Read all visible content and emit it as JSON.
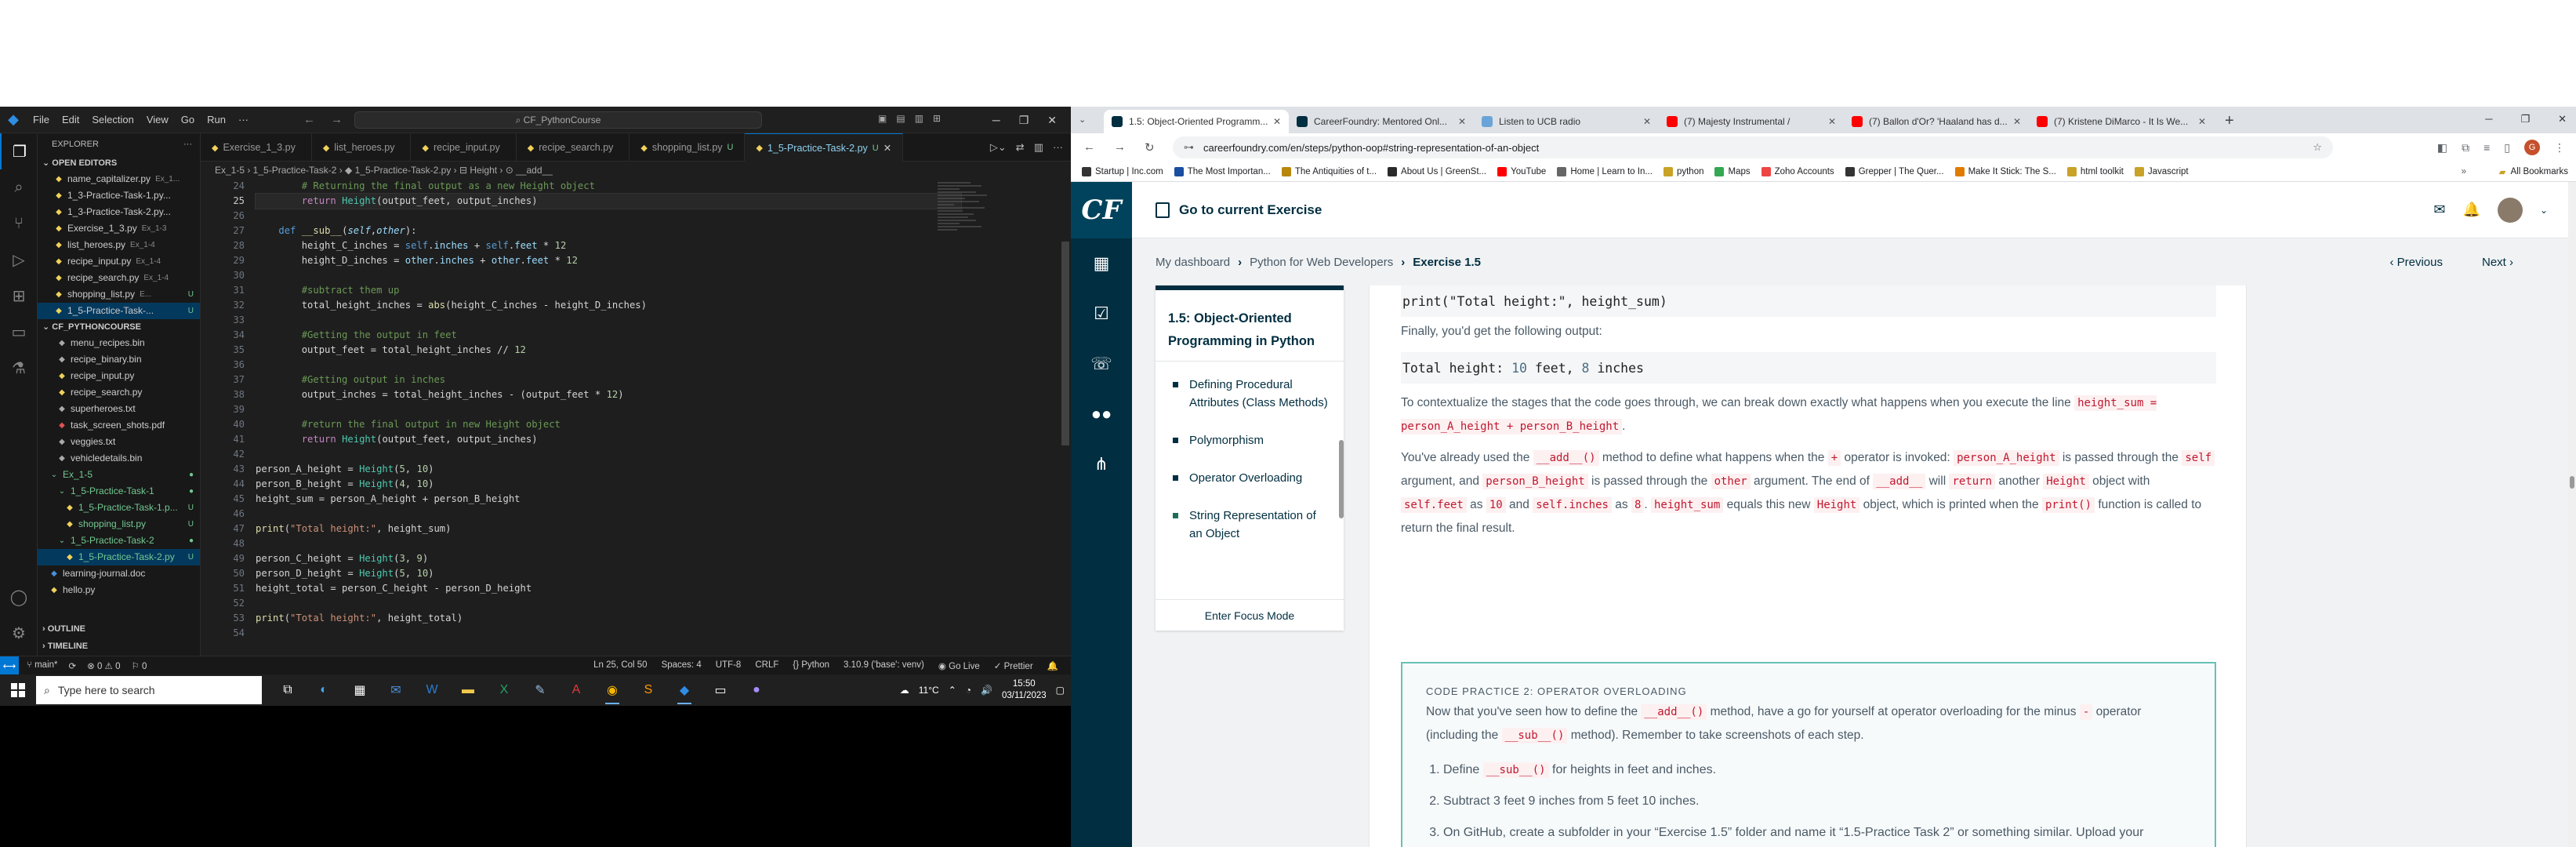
{
  "vscode": {
    "title_search": "CF_PythonCourse",
    "menu": [
      "File",
      "Edit",
      "Selection",
      "View",
      "Go",
      "Run",
      "···"
    ],
    "explorer_title": "EXPLORER",
    "open_editors_label": "OPEN EDITORS",
    "open_editors": [
      {
        "name": "name_capitalizer.py",
        "desc": "Ex_1...",
        "status": "",
        "color": "#f0d25a"
      },
      {
        "name": "1_3-Practice-Task-1.py...",
        "desc": "",
        "status": "",
        "color": "#f0d25a"
      },
      {
        "name": "1_3-Practice-Task-2.py...",
        "desc": "",
        "status": "",
        "color": "#f0d25a"
      },
      {
        "name": "Exercise_1_3.py",
        "desc": "Ex_1-3",
        "status": "",
        "color": "#f0d25a"
      },
      {
        "name": "list_heroes.py",
        "desc": "Ex_1-4",
        "status": "",
        "color": "#f0d25a"
      },
      {
        "name": "recipe_input.py",
        "desc": "Ex_1-4",
        "status": "",
        "color": "#f0d25a"
      },
      {
        "name": "recipe_search.py",
        "desc": "Ex_1-4",
        "status": "",
        "color": "#f0d25a"
      },
      {
        "name": "shopping_list.py",
        "desc": "E...",
        "status": "U",
        "color": "#f0d25a"
      },
      {
        "name": "1_5-Practice-Task-...",
        "desc": "",
        "status": "U",
        "color": "#f0d25a"
      }
    ],
    "project_label": "CF_PYTHONCOURSE",
    "project_files": [
      {
        "name": "menu_recipes.bin",
        "indent": 1,
        "status": "",
        "color": "#aaa"
      },
      {
        "name": "recipe_binary.bin",
        "indent": 1,
        "status": "",
        "color": "#aaa"
      },
      {
        "name": "recipe_input.py",
        "indent": 1,
        "status": "",
        "color": "#f0d25a"
      },
      {
        "name": "recipe_search.py",
        "indent": 1,
        "status": "",
        "color": "#f0d25a"
      },
      {
        "name": "superheroes.txt",
        "indent": 1,
        "status": "",
        "color": "#aaa"
      },
      {
        "name": "task_screen_shots.pdf",
        "indent": 1,
        "status": "",
        "color": "#e05252"
      },
      {
        "name": "veggies.txt",
        "indent": 1,
        "status": "",
        "color": "#aaa"
      },
      {
        "name": "vehicledetails.bin",
        "indent": 1,
        "status": "",
        "color": "#aaa"
      },
      {
        "name": "Ex_1-5",
        "indent": 0,
        "status": "●",
        "color": "#73c991"
      },
      {
        "name": "1_5-Practice-Task-1",
        "indent": 1,
        "status": "●",
        "color": "#73c991"
      },
      {
        "name": "1_5-Practice-Task-1.p...",
        "indent": 2,
        "status": "U",
        "color": "#f0d25a"
      },
      {
        "name": "shopping_list.py",
        "indent": 2,
        "status": "U",
        "color": "#f0d25a"
      },
      {
        "name": "1_5-Practice-Task-2",
        "indent": 1,
        "status": "●",
        "color": "#73c991"
      },
      {
        "name": "1_5-Practice-Task-2.py",
        "indent": 2,
        "status": "U",
        "color": "#f0d25a"
      },
      {
        "name": "learning-journal.doc",
        "indent": 0,
        "status": "",
        "color": "#4a90d9"
      },
      {
        "name": "hello.py",
        "indent": 0,
        "status": "",
        "color": "#f0d25a"
      }
    ],
    "outline_label": "OUTLINE",
    "timeline_label": "TIMELINE",
    "tabs": [
      {
        "name": "Exercise_1_3.py",
        "u": ""
      },
      {
        "name": "list_heroes.py",
        "u": ""
      },
      {
        "name": "recipe_input.py",
        "u": ""
      },
      {
        "name": "recipe_search.py",
        "u": ""
      },
      {
        "name": "shopping_list.py",
        "u": "U"
      },
      {
        "name": "1_5-Practice-Task-2.py",
        "u": "U"
      }
    ],
    "breadcrumb": "Ex_1-5 › 1_5-Practice-Task-2 › ◆ 1_5-Practice-Task-2.py › ⊟ Height › ⊙ __add__",
    "line_numbers": [
      "24",
      "25",
      "26",
      "27",
      "28",
      "29",
      "30",
      "31",
      "32",
      "33",
      "34",
      "35",
      "36",
      "37",
      "38",
      "39",
      "40",
      "41",
      "42",
      "43",
      "44",
      "45",
      "46",
      "47",
      "48",
      "49",
      "50",
      "51",
      "52",
      "53",
      "54"
    ],
    "status_left": [
      "⑂ main*",
      "⟳",
      "⊗ 0 ⚠ 0",
      "⚐ 0"
    ],
    "status_right": [
      "Ln 25, Col 50",
      "Spaces: 4",
      "UTF-8",
      "CRLF",
      "{} Python",
      "3.10.9 ('base': venv)",
      "◉ Go Live",
      "✓ Prettier",
      "🔔"
    ]
  },
  "taskbar": {
    "search_placeholder": "Type here to search",
    "weather": "11°C",
    "time": "15:50",
    "date": "03/11/2023"
  },
  "chrome": {
    "tabs": [
      {
        "title": "1.5: Object-Oriented Programm...",
        "color": "#012e40",
        "active": true
      },
      {
        "title": "CareerFoundry: Mentored Onl...",
        "color": "#012e40",
        "active": false
      },
      {
        "title": "Listen to UCB radio",
        "color": "#6ba4d8",
        "active": false
      },
      {
        "title": "(7) Majesty Instrumental /",
        "color": "#ff0000",
        "active": false
      },
      {
        "title": "(7) Ballon d'Or? 'Haaland has d...",
        "color": "#ff0000",
        "active": false
      },
      {
        "title": "(7) Kristene DiMarco - It Is We...",
        "color": "#ff0000",
        "active": false
      }
    ],
    "url": "careerfoundry.com/en/steps/python-oop#string-representation-of-an-object",
    "bookmarks": [
      {
        "label": "Startup | Inc.com",
        "color": "#333"
      },
      {
        "label": "The Most Importan...",
        "color": "#1a4ea0"
      },
      {
        "label": "The Antiquities of t...",
        "color": "#b8860b"
      },
      {
        "label": "About Us | GreenSt...",
        "color": "#2a2a2a"
      },
      {
        "label": "YouTube",
        "color": "#ff0000"
      },
      {
        "label": "Home | Learn to In...",
        "color": "#666"
      },
      {
        "label": "python",
        "color": "#c9a227"
      },
      {
        "label": "Maps",
        "color": "#34a853"
      },
      {
        "label": "Zoho Accounts",
        "color": "#e44"
      },
      {
        "label": "Grepper | The Quer...",
        "color": "#333"
      },
      {
        "label": "Make It Stick: The S...",
        "color": "#e07b00"
      },
      {
        "label": "html toolkit",
        "color": "#c9a227"
      },
      {
        "label": "Javascript",
        "color": "#c9a227"
      }
    ],
    "all_bookmarks": "All Bookmarks"
  },
  "cf": {
    "logo": "CF",
    "go_to_exercise": "Go to current Exercise",
    "crumbs": [
      "My dashboard",
      "Python for Web Developers",
      "Exercise 1.5"
    ],
    "previous": "Previous",
    "next": "Next",
    "sidebar_title": "1.5: Object-Oriented Programming in Python",
    "sidebar_items": [
      {
        "label": "Defining Procedural Attributes (Class Methods)"
      },
      {
        "label": "Polymorphism"
      },
      {
        "label": "Operator Overloading"
      },
      {
        "label": "String Representation of an Object"
      }
    ],
    "focus_mode": "Enter Focus Mode",
    "code1_text": "print(\"Total height:\", height_sum)",
    "finally_text": "Finally, you'd get the following output:",
    "output_label": "Total height: ",
    "output_num1": "10",
    "output_mid": " feet, ",
    "output_num2": "8",
    "output_end": " inches",
    "p1_a": "To contextualize the stages that the code goes through, we can break down exactly what happens when you execute the line",
    "p1_code": "height_sum = person_A_height + person_B_height",
    "p2": {
      "t1": "You've already used the",
      "c1": "__add__()",
      "t2": "method to define what happens when the",
      "c2": "+",
      "t3": "operator is invoked:",
      "c3": "person_A_height",
      "t4": "is passed through the",
      "c4": "self",
      "t5": "argument, and",
      "c5": "person_B_height",
      "t6": "is passed through the",
      "c6": "other",
      "t7": "argument. The end of",
      "c7": "__add__",
      "t8": "will",
      "c8": "return",
      "t9": "another",
      "c9": "Height",
      "t10": "object with",
      "c10": "self.feet",
      "t11": "as",
      "c11": "10",
      "t12": "and",
      "c12": "self.inches",
      "t13": "as",
      "c13": "8",
      "c14": "height_sum",
      "t14": "equals this new",
      "c15": "Height",
      "t15": "object, which is printed when the",
      "c16": "print()",
      "t16": "function is called to return the final result."
    },
    "cp": {
      "heading": "CODE PRACTICE 2: OPERATOR OVERLOADING",
      "i1": "Now that you've seen how to define the",
      "c1": "__add__()",
      "i2": "method, have a go for yourself at operator overloading for the minus",
      "c2": "-",
      "i3": "operator (including the",
      "c3": "__sub__()",
      "i4": "method). Remember to take screenshots of each step.",
      "s1a": "Define",
      "s1c": "__sub__()",
      "s1b": "for heights in feet and inches.",
      "s2": "Subtract 3 feet 9 inches from 5 feet 10 inches.",
      "s3": "On GitHub, create a subfolder in your “Exercise 1.5” folder and name it “1.5-Practice Task 2” or something similar. Upload your screenshots."
    }
  }
}
